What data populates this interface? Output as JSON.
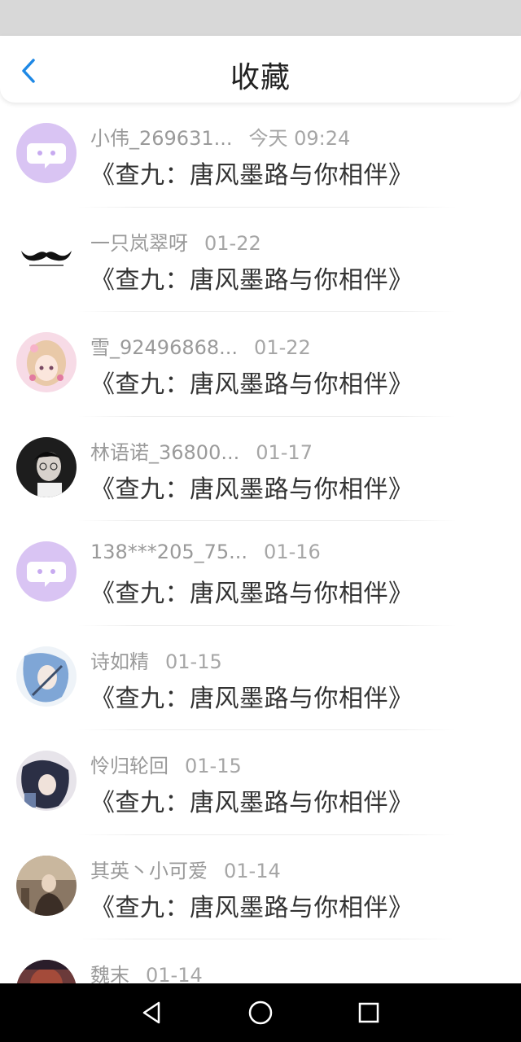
{
  "header": {
    "title": "收藏"
  },
  "items": [
    {
      "name": "小伟_269631...",
      "time": "今天 09:24",
      "title": "《查九：唐风墨路与你相伴》",
      "avatar": "bubble-avatar"
    },
    {
      "name": "一只岚翠呀",
      "time": "01-22",
      "title": "《查九：唐风墨路与你相伴》",
      "avatar": "mustache-avatar"
    },
    {
      "name": "雪_92496868...",
      "time": "01-22",
      "title": "《查九：唐风墨路与你相伴》",
      "avatar": "girl-avatar"
    },
    {
      "name": "林语诺_36800...",
      "time": "01-17",
      "title": "《查九：唐风墨路与你相伴》",
      "avatar": "boy-photo-avatar"
    },
    {
      "name": "138***205_75...",
      "time": "01-16",
      "title": "《查九：唐风墨路与你相伴》",
      "avatar": "bubble-avatar"
    },
    {
      "name": "诗如精",
      "time": "01-15",
      "title": "《查九：唐风墨路与你相伴》",
      "avatar": "anime-blue-avatar"
    },
    {
      "name": "怜归轮回",
      "time": "01-15",
      "title": "《查九：唐风墨路与你相伴》",
      "avatar": "anime-dark-avatar"
    },
    {
      "name": "其英丶小可爱",
      "time": "01-14",
      "title": "《查九：唐风墨路与你相伴》",
      "avatar": "photo-avatar"
    },
    {
      "name": "魏末",
      "time": "01-14",
      "title": "",
      "avatar": "photo-dark-avatar"
    }
  ],
  "colors": {
    "accent": "#1e88e5",
    "bubble": "#d8c3f2",
    "meta": "#9a9a9a",
    "title": "#333333"
  },
  "nav": {
    "back": "triangle-back-icon",
    "home": "circle-home-icon",
    "recents": "square-recents-icon"
  }
}
